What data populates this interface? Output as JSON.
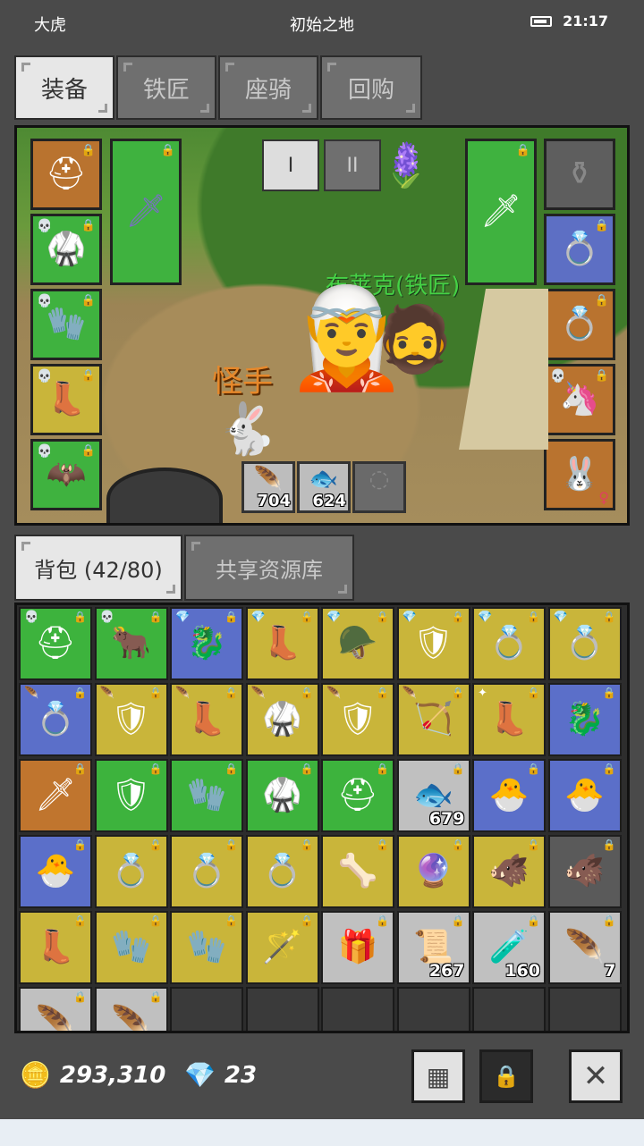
{
  "status_bar": {
    "player_name": "大虎",
    "location": "初始之地",
    "time": "21:17"
  },
  "equip_tabs": [
    {
      "label": "装备",
      "active": true
    },
    {
      "label": "铁匠",
      "active": false
    },
    {
      "label": "座骑",
      "active": false
    },
    {
      "label": "回购",
      "active": false
    }
  ],
  "scene": {
    "page_buttons": [
      "I",
      "II"
    ],
    "npc_name": "布莱克(铁匠)",
    "pet_name": "怪手",
    "quick_slots": [
      {
        "icon": "red-wing",
        "glyph": "🪶",
        "count": "704"
      },
      {
        "icon": "fish",
        "glyph": "🐟",
        "count": "624"
      },
      {
        "icon": "empty",
        "glyph": "",
        "count": ""
      }
    ],
    "left_slots": [
      {
        "name": "helmet",
        "glyph": "⛑",
        "color": "brown",
        "skull": false
      },
      {
        "name": "armor",
        "glyph": "🥋",
        "color": "green",
        "skull": true
      },
      {
        "name": "gloves",
        "glyph": "🧤",
        "color": "green",
        "skull": true
      },
      {
        "name": "boots",
        "glyph": "👢",
        "color": "green",
        "skull": true
      },
      {
        "name": "shoulder",
        "glyph": "🦇",
        "color": "green",
        "skull": true
      }
    ],
    "right_slots": [
      {
        "name": "ring",
        "glyph": "💍",
        "color": "blue"
      },
      {
        "name": "ring",
        "glyph": "💍",
        "color": "brown"
      },
      {
        "name": "mount",
        "glyph": "🦄",
        "color": "brown"
      },
      {
        "name": "pet",
        "glyph": "🐰",
        "color": "brown"
      }
    ]
  },
  "bag_tabs": [
    {
      "label": "背包 (42/80)",
      "active": true
    },
    {
      "label": "共享资源库",
      "active": false
    }
  ],
  "inventory": [
    {
      "icon": "helmet",
      "glyph": "⛑",
      "color": "green",
      "tag": "💀",
      "count": ""
    },
    {
      "icon": "head",
      "glyph": "🐂",
      "color": "green",
      "tag": "💀",
      "count": ""
    },
    {
      "icon": "dragon-head",
      "glyph": "🐉",
      "color": "blue",
      "tag": "💎",
      "count": ""
    },
    {
      "icon": "boots",
      "glyph": "👢",
      "color": "yellow",
      "tag": "💎",
      "count": ""
    },
    {
      "icon": "horned-helmet",
      "glyph": "🪖",
      "color": "yellow",
      "tag": "💎",
      "count": ""
    },
    {
      "icon": "armor",
      "glyph": "🛡",
      "color": "yellow",
      "tag": "💎",
      "count": ""
    },
    {
      "icon": "ring",
      "glyph": "💍",
      "color": "yellow",
      "tag": "💎",
      "count": ""
    },
    {
      "icon": "ring",
      "glyph": "💍",
      "color": "yellow",
      "tag": "💎",
      "count": ""
    },
    {
      "icon": "ring",
      "glyph": "💍",
      "color": "blue",
      "tag": "🪶",
      "count": ""
    },
    {
      "icon": "shield",
      "glyph": "🛡",
      "color": "yellow",
      "tag": "🪶",
      "count": ""
    },
    {
      "icon": "boots",
      "glyph": "👢",
      "color": "yellow",
      "tag": "🪶",
      "count": ""
    },
    {
      "icon": "armor",
      "glyph": "🥋",
      "color": "yellow",
      "tag": "🪶",
      "count": ""
    },
    {
      "icon": "armor",
      "glyph": "🛡",
      "color": "yellow",
      "tag": "🪶",
      "count": ""
    },
    {
      "icon": "crossbow",
      "glyph": "🏹",
      "color": "yellow",
      "tag": "🪶",
      "count": ""
    },
    {
      "icon": "boots",
      "glyph": "👢",
      "color": "yellow",
      "tag": "✦",
      "count": ""
    },
    {
      "icon": "dragon-head",
      "glyph": "🐉",
      "color": "blue",
      "tag": "",
      "count": ""
    },
    {
      "icon": "sword",
      "glyph": "🗡",
      "color": "orange",
      "tag": "",
      "count": ""
    },
    {
      "icon": "shield",
      "glyph": "🛡",
      "color": "green",
      "tag": "",
      "count": ""
    },
    {
      "icon": "gloves",
      "glyph": "🧤",
      "color": "green",
      "tag": "",
      "count": ""
    },
    {
      "icon": "armor",
      "glyph": "🥋",
      "color": "green",
      "tag": "",
      "count": ""
    },
    {
      "icon": "helmet",
      "glyph": "⛑",
      "color": "green",
      "tag": "",
      "count": ""
    },
    {
      "icon": "fish",
      "glyph": "🐟",
      "color": "gray",
      "tag": "",
      "count": "679"
    },
    {
      "icon": "pet-egg",
      "glyph": "🐣",
      "color": "blue",
      "tag": "",
      "count": ""
    },
    {
      "icon": "pet-egg",
      "glyph": "🐣",
      "color": "blue",
      "tag": "",
      "count": ""
    },
    {
      "icon": "pet-egg",
      "glyph": "🐣",
      "color": "blue",
      "tag": "",
      "count": ""
    },
    {
      "icon": "ring",
      "glyph": "💍",
      "color": "yellow",
      "tag": "",
      "count": ""
    },
    {
      "icon": "ring",
      "glyph": "💍",
      "color": "yellow",
      "tag": "",
      "count": ""
    },
    {
      "icon": "ring",
      "glyph": "💍",
      "color": "yellow",
      "tag": "",
      "count": ""
    },
    {
      "icon": "amulet",
      "glyph": "🦴",
      "color": "yellow",
      "tag": "",
      "count": ""
    },
    {
      "icon": "orb",
      "glyph": "🔮",
      "color": "yellow",
      "tag": "",
      "count": ""
    },
    {
      "icon": "boar",
      "glyph": "🐗",
      "color": "yellow",
      "tag": "",
      "count": ""
    },
    {
      "icon": "boar",
      "glyph": "🐗",
      "color": "dark",
      "tag": "",
      "count": ""
    },
    {
      "icon": "boots",
      "glyph": "👢",
      "color": "yellow",
      "tag": "",
      "count": ""
    },
    {
      "icon": "gauntlet",
      "glyph": "🧤",
      "color": "yellow",
      "tag": "",
      "count": ""
    },
    {
      "icon": "gauntlet",
      "glyph": "🧤",
      "color": "yellow",
      "tag": "",
      "count": ""
    },
    {
      "icon": "staff",
      "glyph": "🪄",
      "color": "yellow",
      "tag": "",
      "count": ""
    },
    {
      "icon": "green-cloth",
      "glyph": "🎁",
      "color": "gray",
      "tag": "",
      "count": ""
    },
    {
      "icon": "scroll",
      "glyph": "📜",
      "color": "gray",
      "tag": "",
      "count": "267"
    },
    {
      "icon": "potion",
      "glyph": "🧪",
      "color": "gray",
      "tag": "",
      "count": "160"
    },
    {
      "icon": "purple-feather",
      "glyph": "🪶",
      "color": "gray",
      "tag": "",
      "count": "7"
    },
    {
      "icon": "blue-wing",
      "glyph": "🪶",
      "color": "gray",
      "tag": "",
      "count": ""
    },
    {
      "icon": "red-wing",
      "glyph": "🪶",
      "color": "gray",
      "tag": "",
      "count": ""
    },
    {
      "icon": "empty",
      "glyph": "",
      "color": "empty",
      "tag": "",
      "count": ""
    },
    {
      "icon": "empty",
      "glyph": "",
      "color": "empty",
      "tag": "",
      "count": ""
    },
    {
      "icon": "empty",
      "glyph": "",
      "color": "empty",
      "tag": "",
      "count": ""
    },
    {
      "icon": "empty",
      "glyph": "",
      "color": "empty",
      "tag": "",
      "count": ""
    },
    {
      "icon": "empty",
      "glyph": "",
      "color": "empty",
      "tag": "",
      "count": ""
    },
    {
      "icon": "empty",
      "glyph": "",
      "color": "empty",
      "tag": "",
      "count": ""
    }
  ],
  "currency": {
    "gold": "293,310",
    "gems": "23"
  },
  "colors": {
    "green": "#3db33d",
    "yellow": "#c9b53a",
    "blue": "#5b6fc9",
    "orange": "#c0752e",
    "npc_label": "#45d145",
    "pet_label": "#e7882a"
  }
}
